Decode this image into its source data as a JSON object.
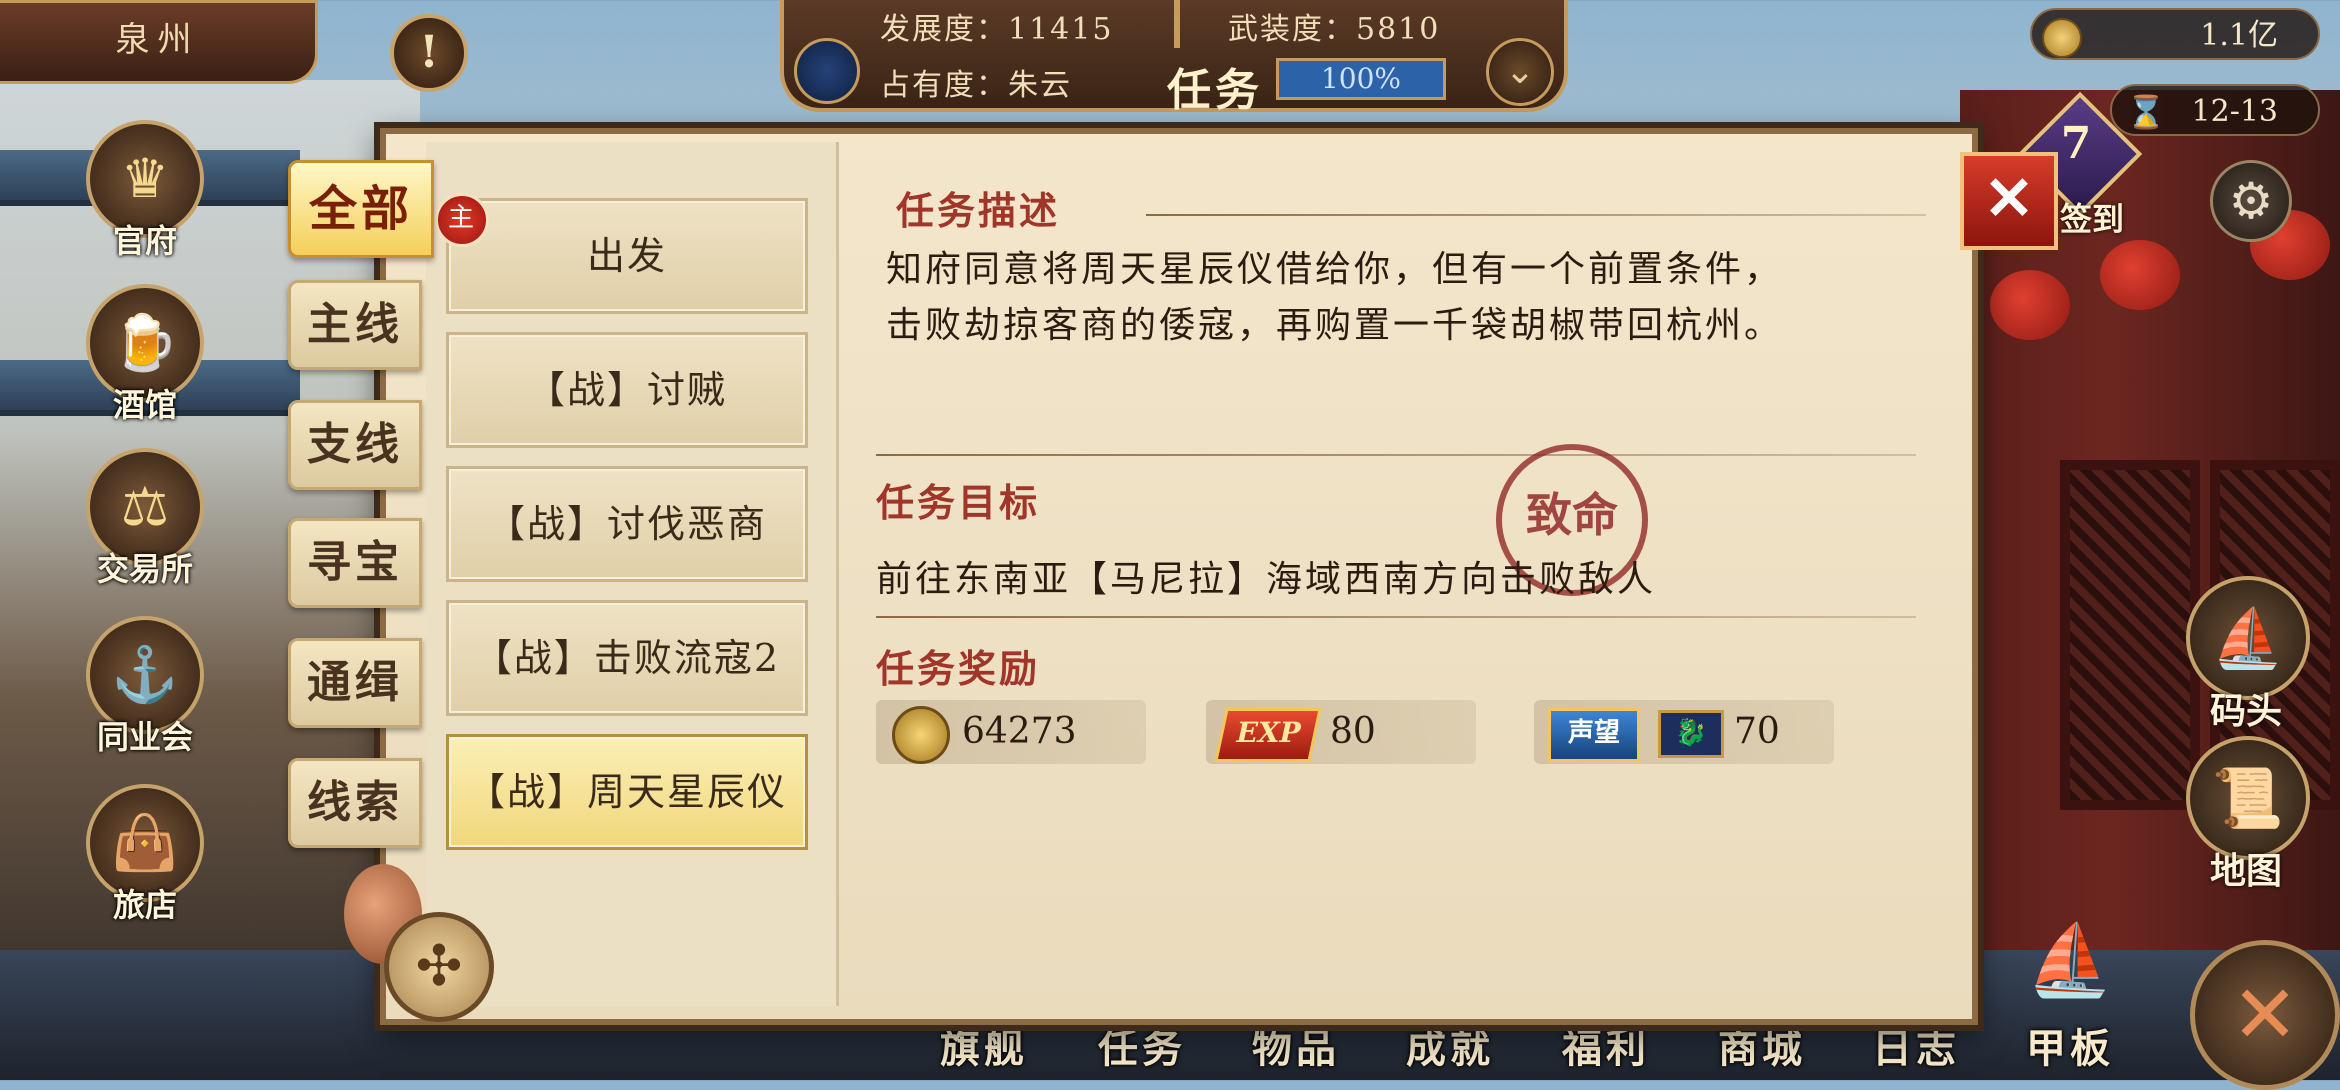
{
  "city": "泉州",
  "stats": {
    "development": "发展度：11415",
    "armament": "武装度：5810",
    "occupation": "占有度：朱云",
    "task_title": "任务",
    "progress_text": "100%",
    "progress_fraction": 1.0
  },
  "resources": {
    "gold": "1.1亿",
    "date": "12-13"
  },
  "signin": {
    "day": "7",
    "label": "签到"
  },
  "left_nav": [
    "官府",
    "酒馆",
    "交易所",
    "同业会",
    "旅店"
  ],
  "right_nav": [
    "码头",
    "地图"
  ],
  "bottom_menu": [
    "旗舰",
    "任务",
    "物品",
    "成就",
    "福利",
    "商城",
    "日志",
    "甲板"
  ],
  "tabs": [
    "全部",
    "主线",
    "支线",
    "寻宝",
    "通缉",
    "线索"
  ],
  "quests": [
    {
      "label": "出发",
      "main": "主"
    },
    {
      "label": "【战】讨贼"
    },
    {
      "label": "【战】讨伐恶商"
    },
    {
      "label": "【战】击败流寇2"
    },
    {
      "label": "【战】周天星辰仪"
    }
  ],
  "detail": {
    "desc_title": "任务描述",
    "desc_line1": "知府同意将周天星辰仪借给你，但有一个前置条件，",
    "desc_line2": "击败劫掠客商的倭寇，再购置一千袋胡椒带回杭州。",
    "target_title": "任务目标",
    "target_text": "前往东南亚【马尼拉】海域西南方向击败敌人",
    "stamp": "致命",
    "reward_title": "任务奖励",
    "reward_gold": "64273",
    "reward_exp_label": "EXP",
    "reward_exp": "80",
    "reward_rep_label": "声望",
    "reward_rep": "70"
  },
  "colors": {
    "accent_red": "#a1352a",
    "panel": "#eadbbd",
    "frame": "#8c6a44"
  }
}
